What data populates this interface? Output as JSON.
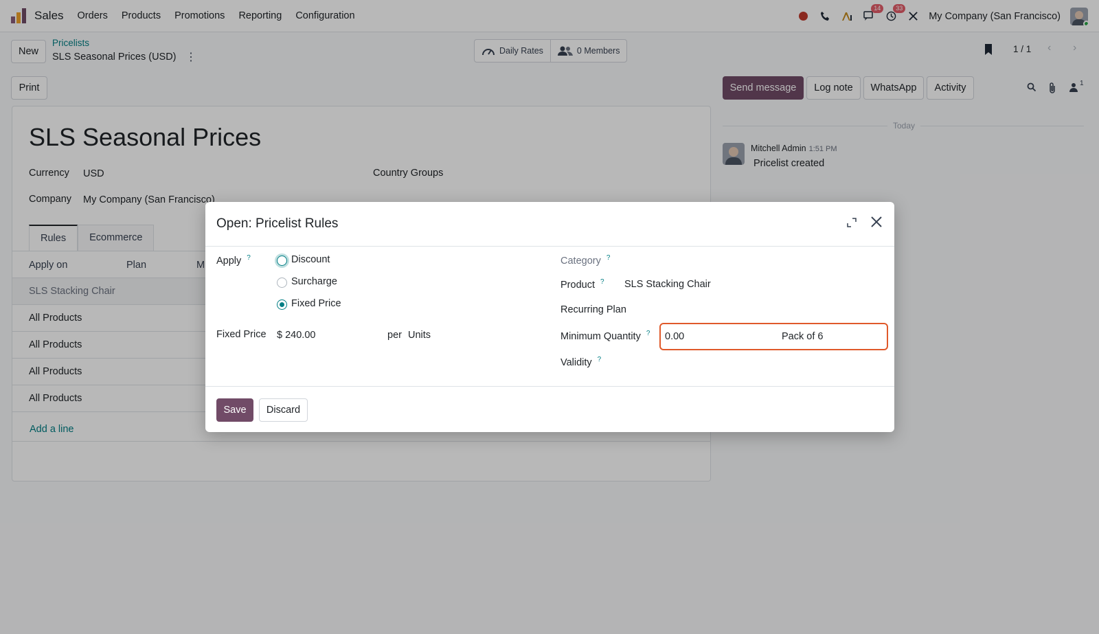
{
  "topbar": {
    "app_name": "Sales",
    "menu": [
      "Orders",
      "Products",
      "Promotions",
      "Reporting",
      "Configuration"
    ],
    "badges": {
      "discuss": "14",
      "activities": "33"
    },
    "company": "My Company (San Francisco)",
    "colors": {
      "brand": "#714b67",
      "accent": "#017e84",
      "badge": "#e35d6a"
    }
  },
  "control_panel": {
    "new_label": "New",
    "breadcrumb_parent": "Pricelists",
    "breadcrumb_current": "SLS Seasonal Prices (USD)",
    "kebab": "⋮",
    "smart_daily_rates": "Daily Rates",
    "smart_members": "0 Members",
    "pager": "1 / 1",
    "print_label": "Print"
  },
  "record": {
    "title": "SLS Seasonal Prices",
    "currency_label": "Currency",
    "currency_value": "USD",
    "company_label": "Company",
    "company_value": "My Company (San Francisco)",
    "country_groups_label": "Country Groups",
    "tabs": [
      "Rules",
      "Ecommerce"
    ],
    "columns": [
      "Apply on",
      "Plan",
      "M"
    ],
    "rows": [
      "SLS Stacking Chair",
      "All Products",
      "All Products",
      "All Products",
      "All Products"
    ],
    "add_line": "Add a line"
  },
  "chatter": {
    "send_message": "Send message",
    "log_note": "Log note",
    "whatsapp": "WhatsApp",
    "activity": "Activity",
    "followers_count": "1",
    "today": "Today",
    "author": "Mitchell Admin",
    "time": "1:51 PM",
    "body": "Pricelist created"
  },
  "modal": {
    "title": "Open: Pricelist Rules",
    "apply_label": "Apply",
    "help_mark": "?",
    "apply_options": [
      "Discount",
      "Surcharge",
      "Fixed Price"
    ],
    "apply_selected": "Fixed Price",
    "fixed_price_label": "Fixed Price",
    "fixed_price_value": "$ 240.00",
    "per_label": "per",
    "uom_value": "Units",
    "category_label": "Category",
    "product_label": "Product",
    "product_value": "SLS Stacking Chair",
    "recurring_plan_label": "Recurring Plan",
    "min_qty_label": "Minimum Quantity",
    "min_qty_value": "0.00",
    "min_qty_uom": "Pack of 6",
    "validity_label": "Validity",
    "save_label": "Save",
    "discard_label": "Discard"
  }
}
